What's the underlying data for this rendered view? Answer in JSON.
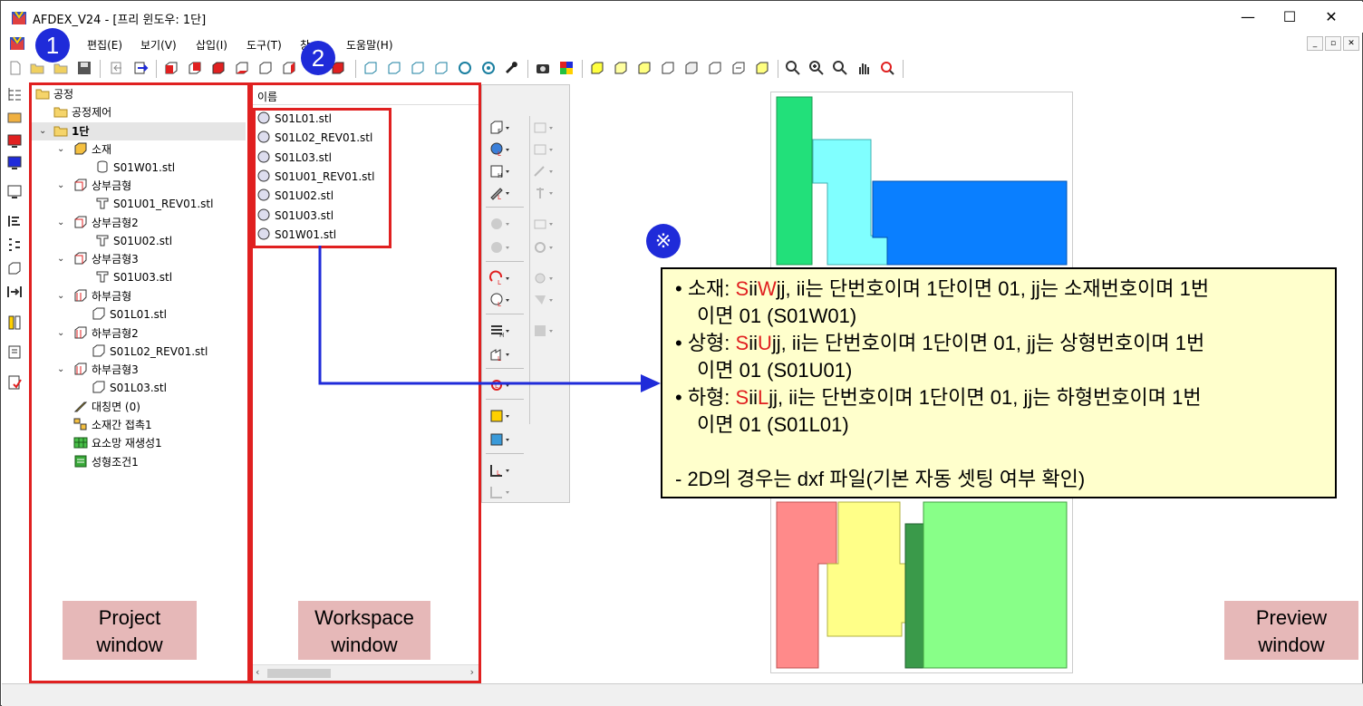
{
  "window": {
    "title": "AFDEX_V24 - [프리 윈도우: 1단]",
    "min": "—",
    "max": "☐",
    "close": "✕"
  },
  "menu": {
    "items": [
      "편집(E)",
      "보기(V)",
      "삽입(I)",
      "도구(T)",
      "창",
      "도움말(H)"
    ]
  },
  "project_tree": {
    "root": "공정",
    "process_control": "공정제어",
    "stage": "1단",
    "material_group": "소재",
    "material_file": "S01W01.stl",
    "upper_die_1": "상부금형",
    "upper_die_1_file": "S01U01_REV01.stl",
    "upper_die_2": "상부금형2",
    "upper_die_2_file": "S01U02.stl",
    "upper_die_3": "상부금형3",
    "upper_die_3_file": "S01U03.stl",
    "lower_die_1": "하부금형",
    "lower_die_1_file": "S01L01.stl",
    "lower_die_2": "하부금형2",
    "lower_die_2_file": "S01L02_REV01.stl",
    "lower_die_3": "하부금형3",
    "lower_die_3_file": "S01L03.stl",
    "symmetry": "대칭면 (0)",
    "contact": "소재간 접촉1",
    "remesh": "요소망 재생성1",
    "forming": "성형조건1"
  },
  "workspace": {
    "header": "이름",
    "files": [
      "S01L01.stl",
      "S01L02_REV01.stl",
      "S01L03.stl",
      "S01U01_REV01.stl",
      "S01U02.stl",
      "S01U03.stl",
      "S01W01.stl"
    ]
  },
  "labels": {
    "project": [
      "Project",
      "window"
    ],
    "workspace": [
      "Workspace",
      "window"
    ],
    "preview": [
      "Preview",
      "window"
    ]
  },
  "badges": {
    "one": "1",
    "two": "2",
    "ref": "※"
  },
  "callout": {
    "l1_pre": "• 소재: ",
    "l1_s": "S",
    "l1_ii": "ii",
    "l1_code": "W",
    "l1_post": "jj, ii는 단번호이며 1단이면 01, jj는 소재번호이며 1번",
    "l1_cont": "이면 01 (S01W01)",
    "l2_pre": "• 상형: ",
    "l2_s": "S",
    "l2_ii": "ii",
    "l2_code": "U",
    "l2_post": "jj, ii는 단번호이며 1단이면 01, jj는 상형번호이며 1번",
    "l2_cont": "이면 01 (S01U01)",
    "l3_pre": "• 하형: ",
    "l3_s": "S",
    "l3_ii": "ii",
    "l3_code": "L",
    "l3_post": "jj, ii는 단번호이며 1단이면 01, jj는 하형번호이며 1번",
    "l3_cont": "이면 01 (S01L01)",
    "note": "- 2D의 경우는 dxf 파일(기본 자동 셋팅 여부 확인)"
  },
  "colors": {
    "highlight_red": "#e02020",
    "badge_blue": "#1f2bd9",
    "arrow_blue": "#1f2bd9",
    "callout_bg": "#ffffcc",
    "label_bg": "#e6b8b8",
    "part_green": "#22e07a",
    "part_cyan": "#80ffff",
    "part_blue": "#0a7fff",
    "part_red": "#ff8a8a",
    "part_yellow": "#ffff88",
    "part_lightgreen": "#88ff88",
    "part_darkgreen": "#3a9a4a"
  }
}
